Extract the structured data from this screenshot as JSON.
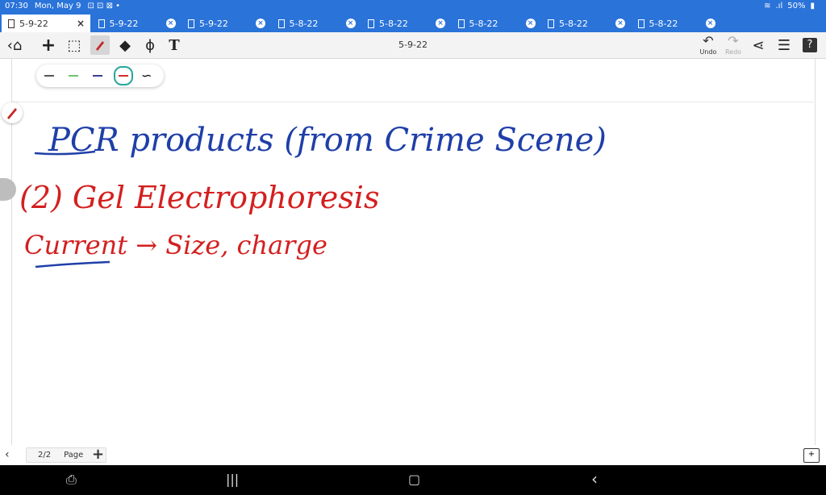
{
  "status": {
    "time": "07:30",
    "date": "Mon, May 9",
    "battery": "50%"
  },
  "tabs": [
    {
      "title": "5-9-22",
      "active": true
    },
    {
      "title": "5-9-22",
      "active": false
    },
    {
      "title": "5-9-22",
      "active": false
    },
    {
      "title": "5-8-22",
      "active": false
    },
    {
      "title": "5-8-22",
      "active": false
    },
    {
      "title": "5-8-22",
      "active": false
    },
    {
      "title": "5-8-22",
      "active": false
    },
    {
      "title": "5-8-22",
      "active": false
    }
  ],
  "toolbar": {
    "doc_title": "5-9-22",
    "undo_label": "Undo",
    "redo_label": "Redo",
    "tools": [
      "back-icon",
      "add-icon",
      "lasso-icon",
      "pen-icon",
      "eraser-icon",
      "select-icon",
      "text-icon"
    ]
  },
  "pens": [
    {
      "color": "#555555"
    },
    {
      "color": "#6cc46c"
    },
    {
      "color": "#3d3d8f"
    },
    {
      "color": "#d62b2b",
      "selected": true
    }
  ],
  "notes": {
    "line1": "PCR products (from Crime Scene)",
    "line2": "(2) Gel Electrophoresis",
    "line3": "Current → Size, charge"
  },
  "pager": {
    "current": "2/2",
    "label": "Page"
  }
}
